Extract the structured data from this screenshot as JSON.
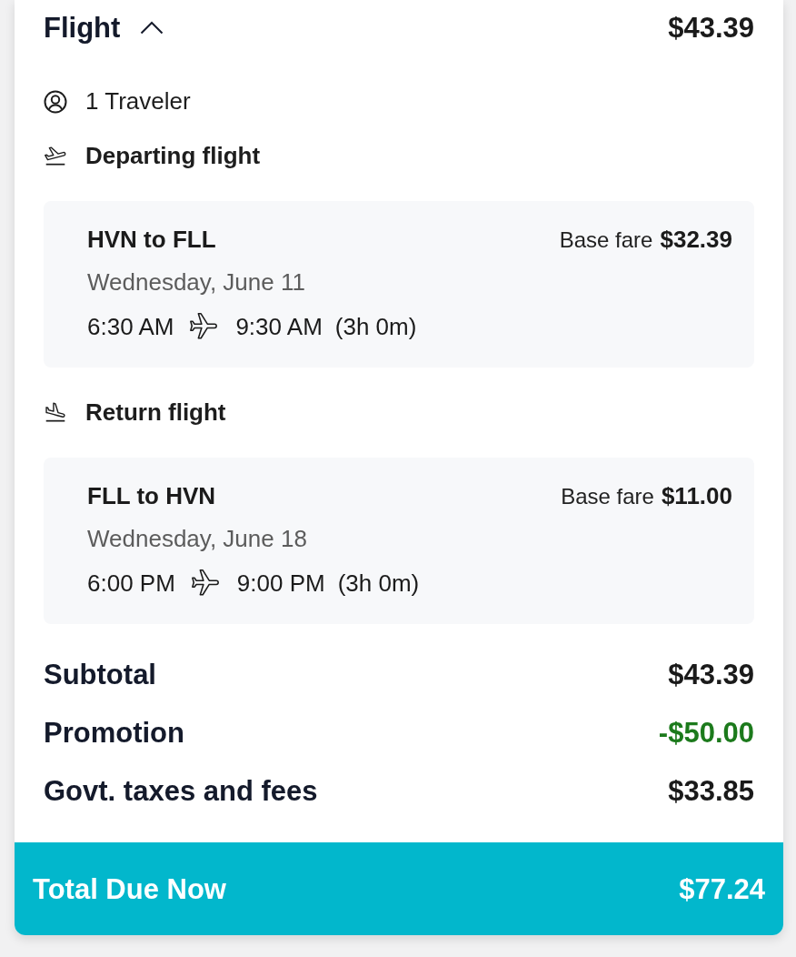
{
  "summary": {
    "title": "Flight",
    "expanded": true,
    "price": "$43.39"
  },
  "travelers": "1 Traveler",
  "legs": [
    {
      "kind": "departing",
      "heading": "Departing flight",
      "route": "HVN to FLL",
      "fare_label": "Base fare",
      "fare": "$32.39",
      "date": "Wednesday, June 11",
      "depart_time": "6:30 AM",
      "arrive_time": "9:30 AM",
      "duration": "(3h 0m)"
    },
    {
      "kind": "return",
      "heading": "Return flight",
      "route": "FLL to HVN",
      "fare_label": "Base fare",
      "fare": "$11.00",
      "date": "Wednesday, June 18",
      "depart_time": "6:00 PM",
      "arrive_time": "9:00 PM",
      "duration": "(3h 0m)"
    }
  ],
  "totals": [
    {
      "kind": "charge",
      "label": "Subtotal",
      "amount": "$43.39"
    },
    {
      "kind": "discount",
      "label": "Promotion",
      "amount": "-$50.00"
    },
    {
      "kind": "charge",
      "label": "Govt. taxes and fees",
      "amount": "$33.85"
    }
  ],
  "total_due": {
    "label": "Total Due Now",
    "amount": "$77.24"
  }
}
